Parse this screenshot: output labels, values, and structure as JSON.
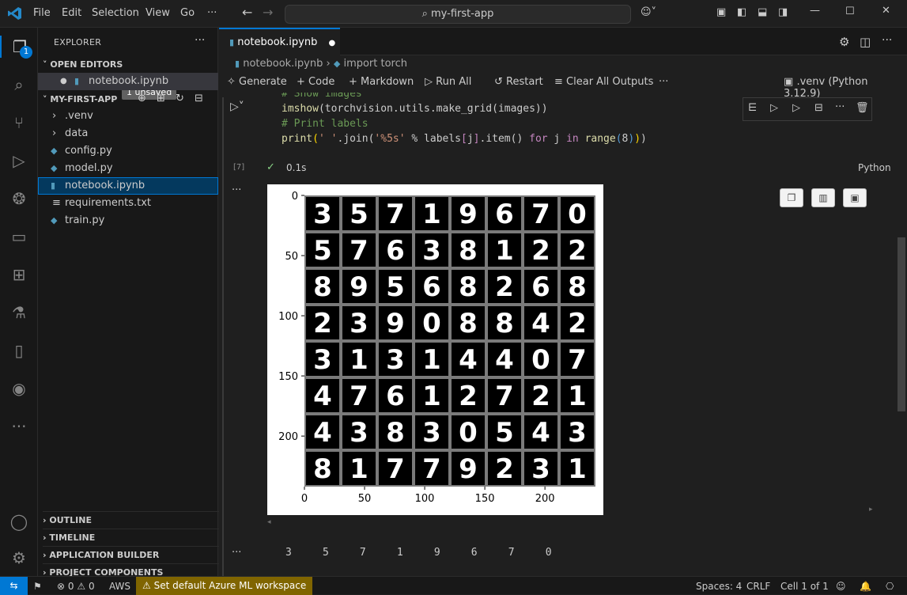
{
  "titlebar": {
    "menus": [
      "File",
      "Edit",
      "Selection",
      "View",
      "Go",
      "···"
    ],
    "search": "my-first-app"
  },
  "activity_badge": "1",
  "sidebar": {
    "title": "EXPLORER",
    "open_editors_title": "OPEN EDITORS",
    "unsaved_badge": "1 unsaved",
    "open_editor_file": "notebook.ipynb",
    "project_title": "MY-FIRST-APP",
    "tree": [
      ".venv",
      "data",
      "config.py",
      "model.py",
      "notebook.ipynb",
      "requirements.txt",
      "train.py"
    ],
    "bottom_sections": [
      "OUTLINE",
      "TIMELINE",
      "APPLICATION BUILDER",
      "PROJECT COMPONENTS"
    ]
  },
  "editor": {
    "tab_label": "notebook.ipynb",
    "breadcrumb_file": "notebook.ipynb",
    "breadcrumb_symbol": "import torch",
    "toolbar": {
      "generate": "Generate",
      "code": "Code",
      "markdown": "Markdown",
      "run_all": "Run All",
      "restart": "Restart",
      "clear": "Clear All Outputs",
      "more": "···",
      "kernel": ".venv (Python 3.12.9)"
    },
    "cell": {
      "line0": "# Show images",
      "line1_fn": "imshow",
      "line1_rest": "(torchvision.utils.make_grid(images))",
      "line2": "# Print labels",
      "exec_count": "[7]",
      "duration": "0.1s",
      "language": "Python"
    },
    "output_labels": "3     5     7     1     9     6     7     0"
  },
  "image_grid": {
    "rows": [
      [
        "3",
        "5",
        "7",
        "1",
        "9",
        "6",
        "7",
        "0"
      ],
      [
        "5",
        "7",
        "6",
        "3",
        "8",
        "1",
        "2",
        "2"
      ],
      [
        "8",
        "9",
        "5",
        "6",
        "8",
        "2",
        "6",
        "8"
      ],
      [
        "2",
        "3",
        "9",
        "0",
        "8",
        "8",
        "4",
        "2"
      ],
      [
        "3",
        "1",
        "3",
        "1",
        "4",
        "4",
        "0",
        "7"
      ],
      [
        "4",
        "7",
        "6",
        "1",
        "2",
        "7",
        "2",
        "1"
      ],
      [
        "4",
        "3",
        "8",
        "3",
        "0",
        "5",
        "4",
        "3"
      ],
      [
        "8",
        "1",
        "7",
        "7",
        "9",
        "2",
        "3",
        "1"
      ]
    ],
    "y_ticks": [
      "0",
      "50",
      "100",
      "150",
      "200"
    ],
    "x_ticks": [
      "0",
      "50",
      "100",
      "150",
      "200"
    ]
  },
  "statusbar": {
    "errors": "0",
    "warnings": "0",
    "aws": "AWS",
    "azure": "Set default Azure ML workspace",
    "spaces": "Spaces: 4",
    "eol": "CRLF",
    "cell": "Cell 1 of 1"
  }
}
